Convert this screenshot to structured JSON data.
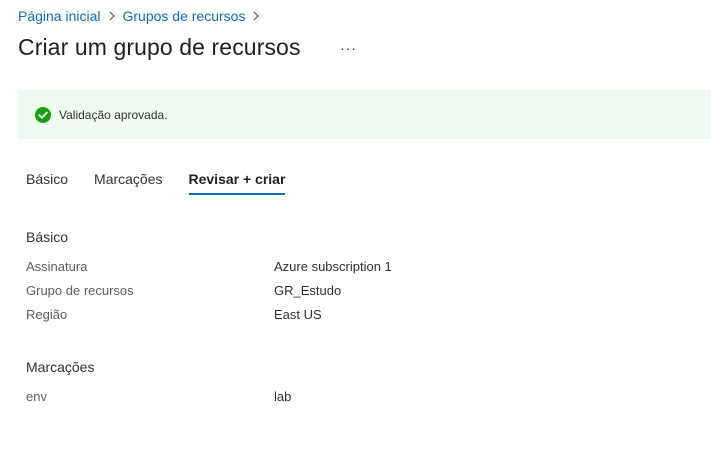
{
  "breadcrumb": {
    "items": [
      "Página inicial",
      "Grupos de recursos"
    ],
    "separator": ">"
  },
  "page": {
    "title": "Criar um grupo de recursos",
    "more_label": "···"
  },
  "banner": {
    "message": "Validação aprovada.",
    "icon": "checkmark-circle-icon",
    "color": "#107c10",
    "background": "#f1faf1"
  },
  "tabs": [
    {
      "label": "Básico",
      "active": false
    },
    {
      "label": "Marcações",
      "active": false
    },
    {
      "label": "Revisar + criar",
      "active": true
    }
  ],
  "sections": {
    "basic": {
      "title": "Básico",
      "rows": [
        {
          "key": "Assinatura",
          "value": "Azure subscription 1"
        },
        {
          "key": "Grupo de recursos",
          "value": "GR_Estudo"
        },
        {
          "key": "Região",
          "value": "East US"
        }
      ]
    },
    "tags": {
      "title": "Marcações",
      "rows": [
        {
          "key": "env",
          "value": "lab"
        }
      ]
    }
  },
  "colors": {
    "link": "#0f6cbd",
    "accent": "#0f6cbd",
    "success": "#107c10"
  }
}
